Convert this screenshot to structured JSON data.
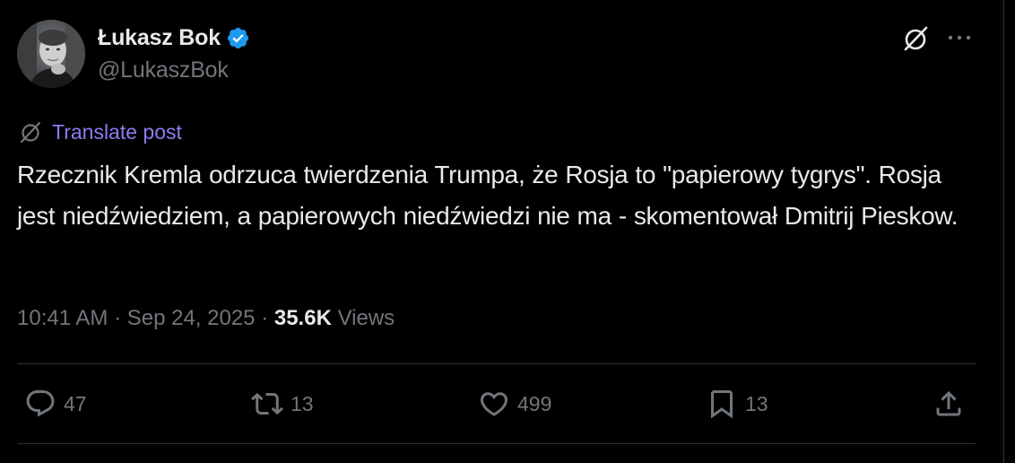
{
  "author": {
    "display_name": "Łukasz Bok",
    "handle": "@LukaszBok",
    "verified": true,
    "avatar": "profile-photo"
  },
  "translate": {
    "label": "Translate post",
    "icon": "grok-icon"
  },
  "tweet": {
    "text": "Rzecznik Kremla odrzuca twierdzenia Trumpa, że Rosja to \"papierowy tygrys\". Rosja jest niedźwiedziem, a papierowych niedźwiedzi nie ma - skomentował Dmitrij Pieskow."
  },
  "meta": {
    "time": "10:41 AM",
    "dot1": " · ",
    "date": "Sep 24, 2025",
    "dot2": " · ",
    "views_count": "35.6K",
    "views_label": " Views"
  },
  "actions": {
    "replies": "47",
    "reposts": "13",
    "likes": "499",
    "bookmarks": "13"
  },
  "colors": {
    "background": "#000000",
    "text_primary": "#e7e9ea",
    "text_secondary": "#71767b",
    "link": "#8a7df2",
    "verified": "#1d9bf0",
    "divider": "#2f3336"
  },
  "icons": {
    "top_right": [
      "grok-icon",
      "more-icon"
    ],
    "actions": [
      "reply-icon",
      "repost-icon",
      "like-icon",
      "bookmark-icon",
      "share-icon"
    ]
  }
}
